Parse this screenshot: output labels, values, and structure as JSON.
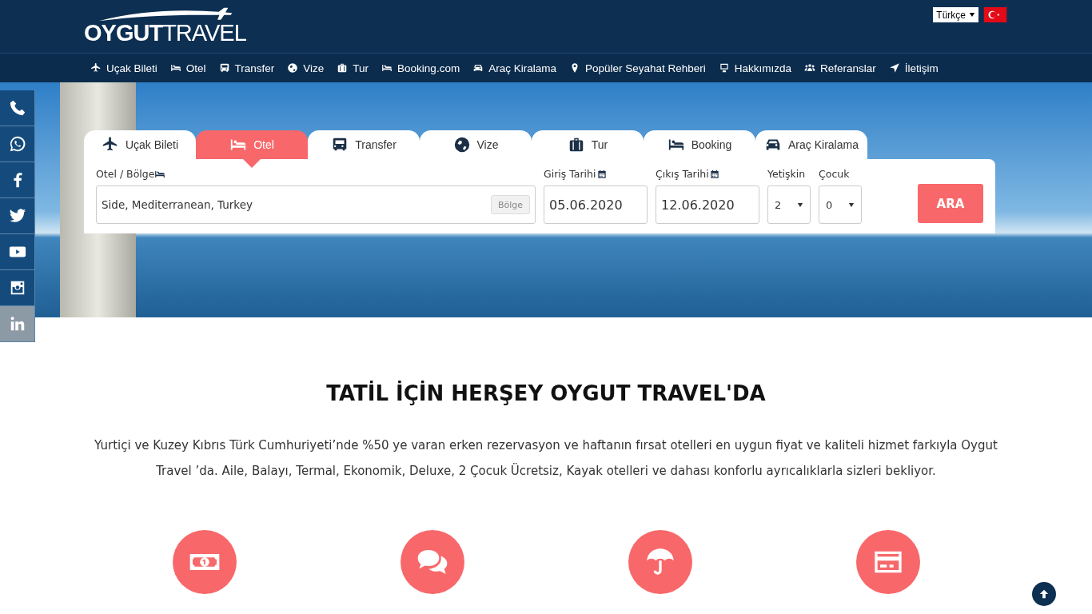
{
  "header": {
    "logo": {
      "part1": "OYGUT",
      "part2": "TRAVEL"
    },
    "language": "Türkçe"
  },
  "nav": [
    {
      "label": "Uçak Bileti"
    },
    {
      "label": "Otel"
    },
    {
      "label": "Transfer"
    },
    {
      "label": "Vize"
    },
    {
      "label": "Tur"
    },
    {
      "label": "Booking.com"
    },
    {
      "label": "Araç Kiralama"
    },
    {
      "label": "Popüler Seyahat Rehberi"
    },
    {
      "label": "Hakkımızda"
    },
    {
      "label": "Referanslar"
    },
    {
      "label": "İletişim"
    }
  ],
  "search": {
    "tabs": [
      {
        "label": "Uçak Bileti",
        "selected": false
      },
      {
        "label": "Otel",
        "selected": true
      },
      {
        "label": "Transfer",
        "selected": false
      },
      {
        "label": "Vize",
        "selected": false
      },
      {
        "label": "Tur",
        "selected": false
      },
      {
        "label": "Booking",
        "selected": false
      },
      {
        "label": "Araç Kiralama",
        "selected": false
      }
    ],
    "region": {
      "label": "Otel / Bölge",
      "value": "Side, Mediterranean, Turkey",
      "button": "Bölge"
    },
    "checkin": {
      "label": "Giriş Tarihi",
      "value": "05.06.2020"
    },
    "checkout": {
      "label": "Çıkış Tarihi",
      "value": "12.06.2020"
    },
    "adults": {
      "label": "Yetişkin",
      "value": "2"
    },
    "children": {
      "label": "Çocuk",
      "value": "0"
    },
    "submit": "ARA"
  },
  "intro": {
    "title": "TATİL İÇİN HERŞEY OYGUT TRAVEL'DA",
    "text": "Yurtiçi ve Kuzey Kıbrıs Türk Cumhuriyeti’nde %50 ye varan erken rezervasyon ve haftanın fırsat otelleri en uygun fiyat ve kaliteli hizmet farkıyla Oygut Travel ’da. Aile, Balayı, Termal, Ekonomik, Deluxe, 2 Çocuk Ücretsiz, Kayak otelleri ve dahası konforlu ayrıcalıklarla sizleri bekliyor."
  }
}
